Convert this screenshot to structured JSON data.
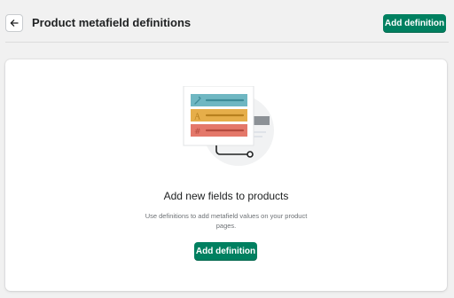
{
  "header": {
    "title": "Product metafield definitions",
    "add_button_label": "Add definition",
    "back_icon": "arrow-left-icon"
  },
  "empty_state": {
    "illustration": "metafield-list-illustration",
    "heading": "Add new fields to products",
    "description": "Use definitions to add metafield values on your product pages.",
    "button_label": "Add definition"
  },
  "colors": {
    "primary": "#008060",
    "teal": "#6fb7c2",
    "yellow": "#e6ae4a",
    "red": "#e4786a",
    "background": "#f1f1f1"
  }
}
